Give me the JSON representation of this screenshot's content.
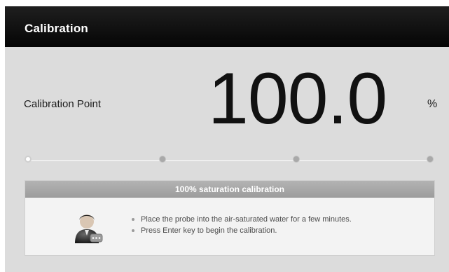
{
  "header": {
    "title": "Calibration"
  },
  "calibration": {
    "label": "Calibration Point",
    "value": "100.0",
    "unit": "%"
  },
  "steps": {
    "count": 4,
    "active_index": 0
  },
  "panel": {
    "title": "100% saturation calibration",
    "icon": "user-operator-icon",
    "instructions": [
      "Place the probe into the air-saturated water for a few minutes.",
      "Press Enter key to begin the calibration."
    ]
  },
  "colors": {
    "titlebar": "#0a0a0a",
    "background": "#dcdcdc",
    "panel_header": "#a6a6a6"
  }
}
